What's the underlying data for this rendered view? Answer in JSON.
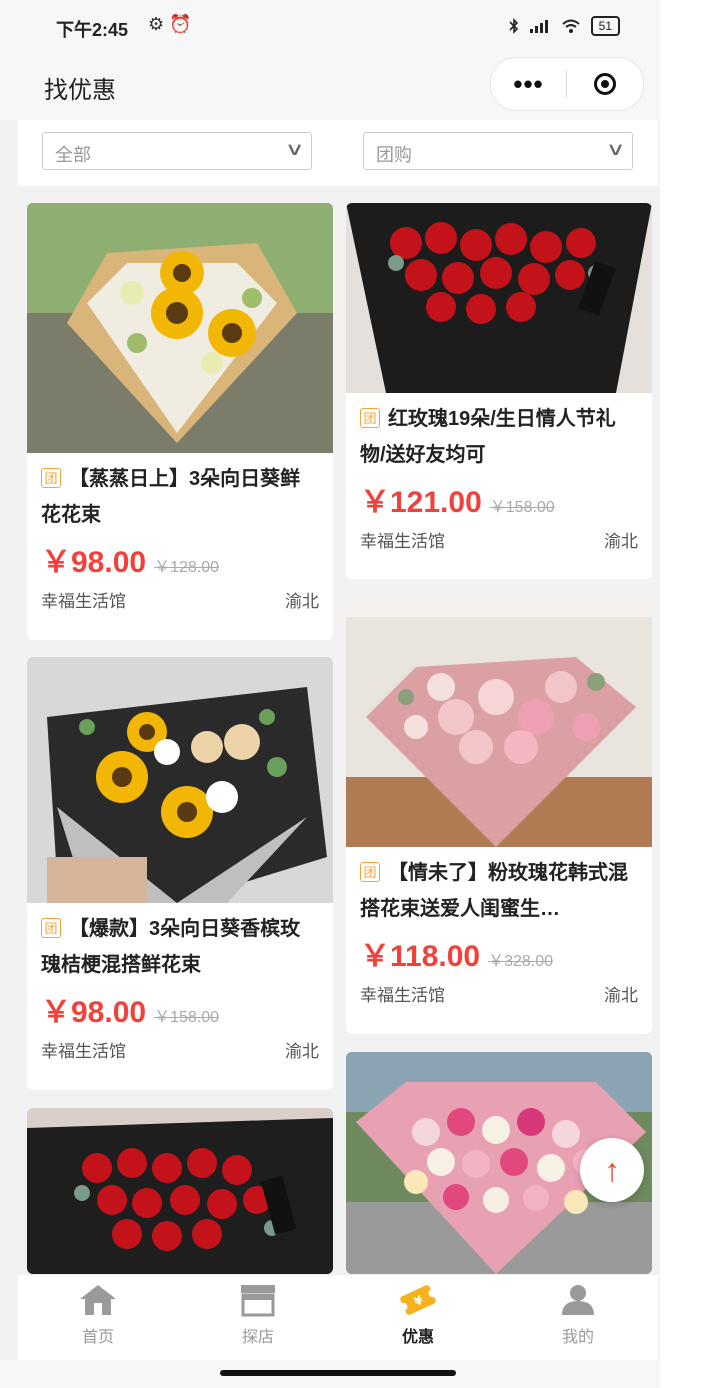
{
  "status": {
    "time": "下午2:45",
    "left_icons": "⚙ ⏰",
    "battery": "51"
  },
  "nav": {
    "title": "找优惠",
    "more": "•••"
  },
  "filters": [
    {
      "value": "全部"
    },
    {
      "value": "团购"
    }
  ],
  "tag_char": "团",
  "cards": [
    {
      "title": "【蒸蒸日上】3朵向日葵鲜花花束",
      "price": "￥98.00",
      "orig": "￥128.00",
      "shop": "幸福生活馆",
      "area": "渝北"
    },
    {
      "title": "红玫瑰19朵/生日情人节礼物/送好友均可",
      "price": "￥121.00",
      "orig": "￥158.00",
      "shop": "幸福生活馆",
      "area": "渝北"
    },
    {
      "title": "【爆款】3朵向日葵香槟玫瑰桔梗混搭鲜花束",
      "price": "￥98.00",
      "orig": "￥158.00",
      "shop": "幸福生活馆",
      "area": "渝北"
    },
    {
      "title": "【情未了】粉玫瑰花韩式混搭花束送爱人闺蜜生…",
      "price": "￥118.00",
      "orig": "￥328.00",
      "shop": "幸福生活馆",
      "area": "渝北"
    }
  ],
  "tabs": [
    {
      "label": "首页"
    },
    {
      "label": "探店"
    },
    {
      "label": "优惠"
    },
    {
      "label": "我的"
    }
  ],
  "colors": {
    "accent": "#f0423a",
    "tag": "#f4a33a"
  }
}
